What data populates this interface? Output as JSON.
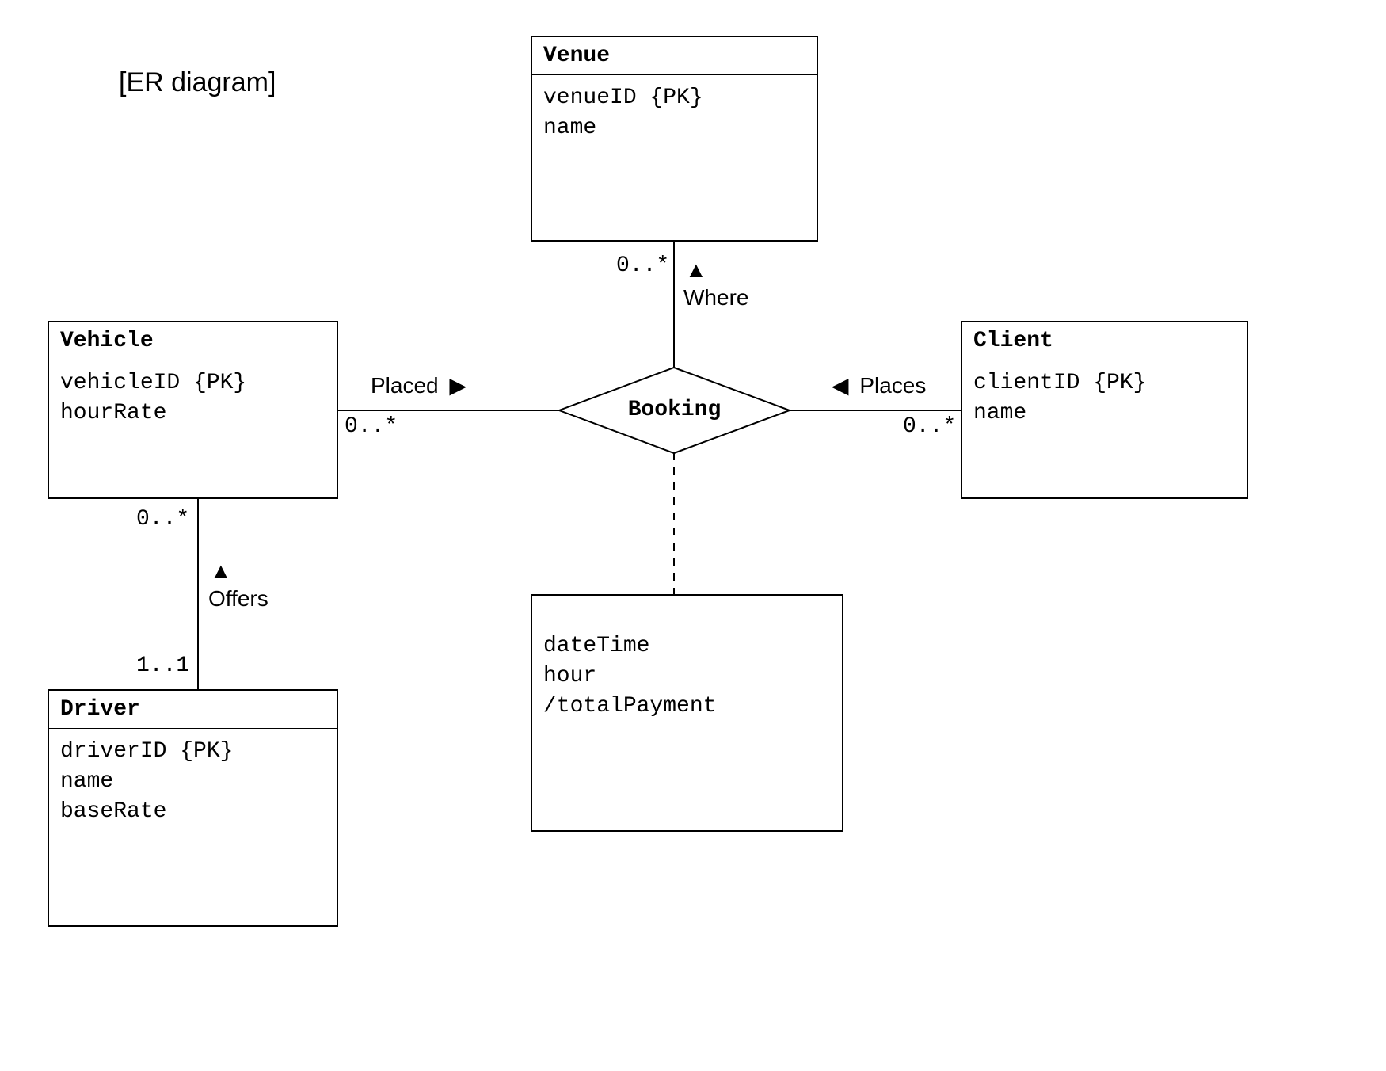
{
  "title": "[ER diagram]",
  "entities": {
    "venue": {
      "name": "Venue",
      "attrs": [
        "venueID {PK}",
        "name"
      ]
    },
    "vehicle": {
      "name": "Vehicle",
      "attrs": [
        "vehicleID {PK}",
        "hourRate"
      ]
    },
    "client": {
      "name": "Client",
      "attrs": [
        "clientID {PK}",
        "name"
      ]
    },
    "driver": {
      "name": "Driver",
      "attrs": [
        "driverID {PK}",
        "name",
        "baseRate"
      ]
    },
    "assoc": {
      "name": "",
      "attrs": [
        "dateTime",
        "hour",
        "/totalPayment"
      ]
    }
  },
  "relationship": {
    "booking": "Booking"
  },
  "labels": {
    "where": "Where",
    "placed": "Placed",
    "places": "Places",
    "offers": "Offers"
  },
  "mults": {
    "venue_side": "0..*",
    "vehicle_side": "0..*",
    "client_side": "0..*",
    "vehicle_offers": "0..*",
    "driver_offers": "1..1"
  },
  "arrows": {
    "up": "▲",
    "right": "▶",
    "left": "◀"
  }
}
